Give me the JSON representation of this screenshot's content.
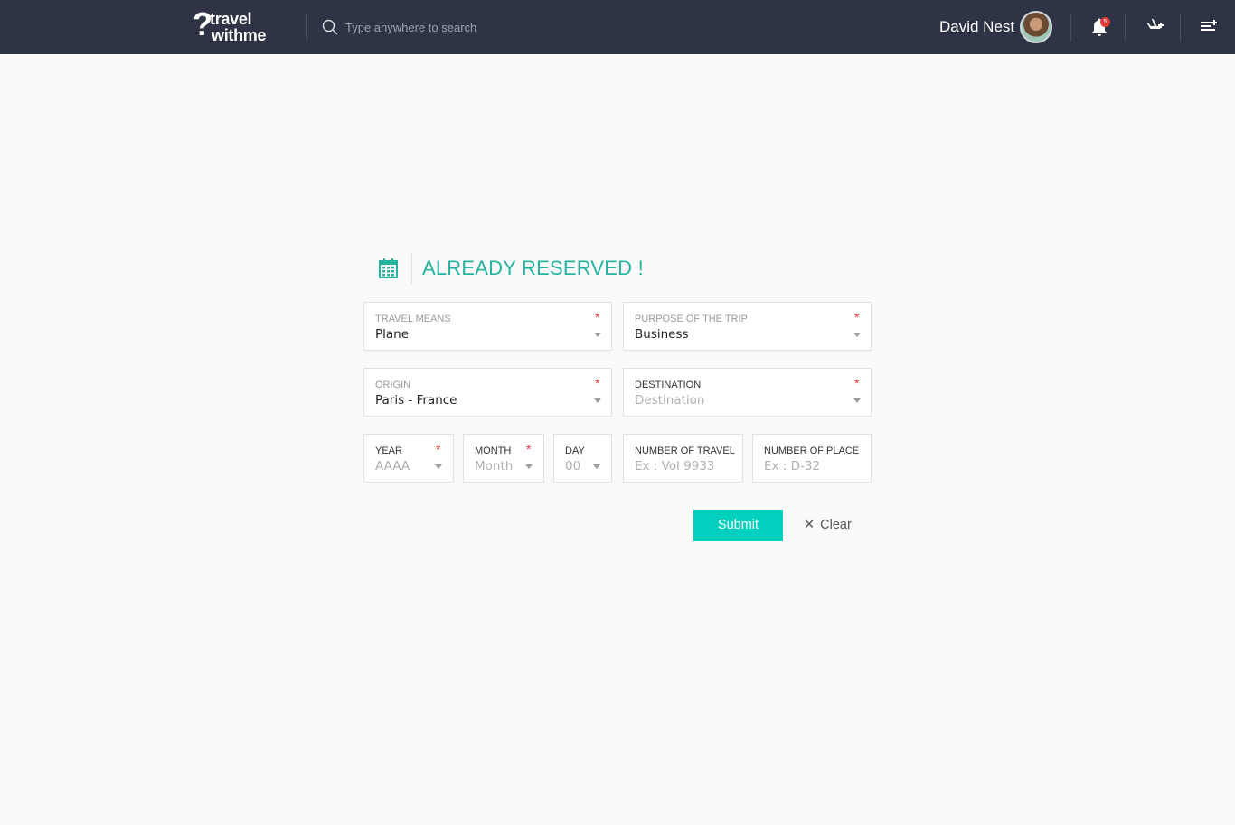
{
  "header": {
    "logo_top": "travel",
    "logo_bottom": "withme",
    "logo_mark": "?",
    "search_placeholder": "Type anywhere to search",
    "search_icon": "search-icon",
    "user_name": "David Nest",
    "notifications_count": "5",
    "icons": [
      "bell-icon",
      "airplane-add-icon",
      "playlist-add-icon"
    ]
  },
  "form": {
    "heading": "ALREADY RESERVED !",
    "heading_icon": "calendar-icon",
    "required_mark": "*",
    "travel_means": {
      "label": "TRAVEL MEANS",
      "value": "Plane"
    },
    "purpose": {
      "label": "PURPOSE OF THE TRIP",
      "value": "Business"
    },
    "origin": {
      "label": "ORIGIN",
      "value": "Paris - France"
    },
    "destination": {
      "label": "DESTINATION",
      "placeholder": "Destination"
    },
    "year": {
      "label": "YEAR",
      "placeholder": "AAAA"
    },
    "month": {
      "label": "MONTH",
      "placeholder": "Month"
    },
    "day": {
      "label": "DAY",
      "placeholder": "00"
    },
    "travel_number": {
      "label": "NUMBER OF TRAVEL",
      "placeholder": "Ex : Vol 9933"
    },
    "place_number": {
      "label": "NUMBER OF PLACE",
      "placeholder": "Ex : D-32"
    },
    "submit_label": "Submit",
    "clear_label": "Clear",
    "clear_mark": "✕"
  },
  "colors": {
    "topbar": "#2e3446",
    "accent": "#26b3a0",
    "submit": "#00d0bd",
    "required": "#e53935"
  }
}
